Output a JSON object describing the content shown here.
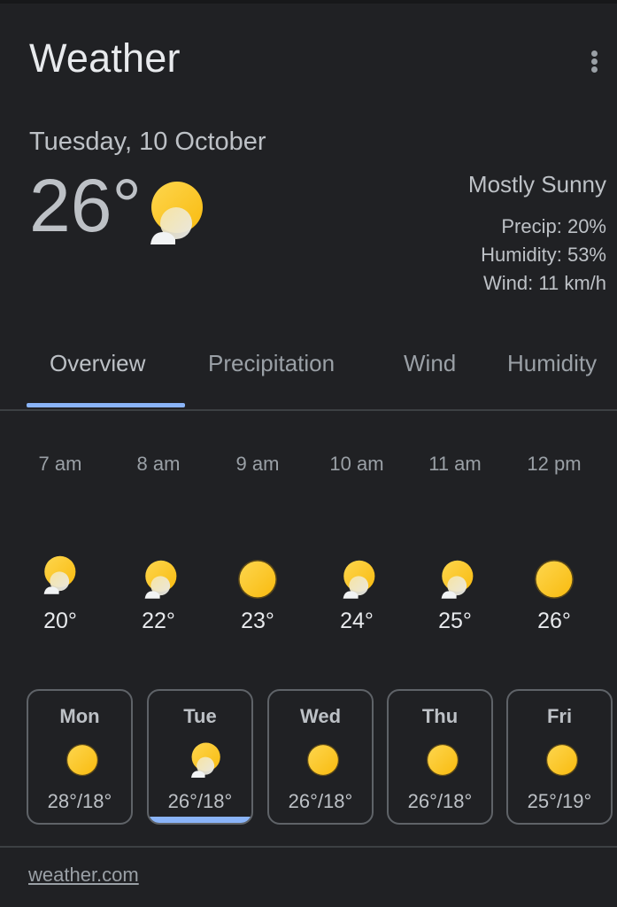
{
  "header": {
    "title": "Weather",
    "menu_icon": "more-vert-icon"
  },
  "current": {
    "date": "Tuesday, 10 October",
    "temperature": "26°",
    "icon": "mostly-sunny-icon",
    "condition": "Mostly Sunny",
    "precip": "Precip: 20%",
    "humidity": "Humidity: 53%",
    "wind": "Wind: 11 km/h"
  },
  "tabs": [
    {
      "label": "Overview",
      "active": true
    },
    {
      "label": "Precipitation",
      "active": false
    },
    {
      "label": "Wind",
      "active": false
    },
    {
      "label": "Humidity",
      "active": false
    }
  ],
  "hourly": [
    {
      "time": "7 am",
      "temp": "20°",
      "icon": "mostly-sunny-icon"
    },
    {
      "time": "8 am",
      "temp": "22°",
      "icon": "mostly-sunny-icon"
    },
    {
      "time": "9 am",
      "temp": "23°",
      "icon": "sunny-icon"
    },
    {
      "time": "10 am",
      "temp": "24°",
      "icon": "mostly-sunny-icon"
    },
    {
      "time": "11 am",
      "temp": "25°",
      "icon": "mostly-sunny-icon"
    },
    {
      "time": "12 pm",
      "temp": "26°",
      "icon": "sunny-icon"
    }
  ],
  "daily": [
    {
      "day": "Mon",
      "temps": "28°/18°",
      "icon": "sunny-icon",
      "selected": false
    },
    {
      "day": "Tue",
      "temps": "26°/18°",
      "icon": "mostly-sunny-icon",
      "selected": true
    },
    {
      "day": "Wed",
      "temps": "26°/18°",
      "icon": "sunny-icon",
      "selected": false
    },
    {
      "day": "Thu",
      "temps": "26°/18°",
      "icon": "sunny-icon",
      "selected": false
    },
    {
      "day": "Fri",
      "temps": "25°/19°",
      "icon": "sunny-icon",
      "selected": false
    }
  ],
  "footer": {
    "source": "weather.com"
  },
  "colors": {
    "background": "#202124",
    "accent": "#8ab4f8",
    "sun": "#fbc02d"
  }
}
